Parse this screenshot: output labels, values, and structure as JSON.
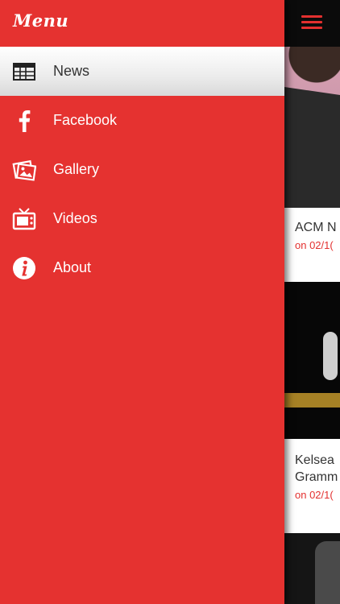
{
  "drawer": {
    "title": "Menu",
    "items": [
      {
        "label": "News",
        "icon": "table-icon",
        "active": true
      },
      {
        "label": "Facebook",
        "icon": "facebook-icon",
        "active": false
      },
      {
        "label": "Gallery",
        "icon": "gallery-icon",
        "active": false
      },
      {
        "label": "Videos",
        "icon": "tv-icon",
        "active": false
      },
      {
        "label": "About",
        "icon": "info-icon",
        "active": false
      }
    ]
  },
  "content": {
    "cards": [
      {
        "headline_lines": [
          "ACM N"
        ],
        "meta": "on 02/1("
      },
      {
        "headline_lines": [
          "Kelsea",
          "Gramm"
        ],
        "meta": "on 02/1("
      }
    ]
  },
  "colors": {
    "accent": "#e53230",
    "active_bg": "#ececec",
    "active_text": "#333333"
  }
}
